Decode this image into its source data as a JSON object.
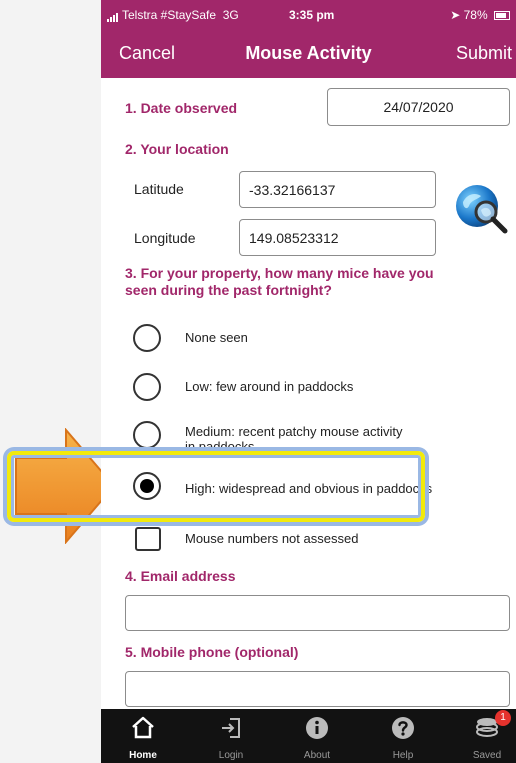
{
  "status": {
    "carrier": "Telstra #StaySafe",
    "network": "3G",
    "time": "3:35 pm",
    "battery": "78%"
  },
  "nav": {
    "cancel": "Cancel",
    "title": "Mouse Activity",
    "submit": "Submit"
  },
  "form": {
    "q1": {
      "label": "1. Date observed",
      "value": "24/07/2020"
    },
    "q2": {
      "label": "2. Your location",
      "latitude_label": "Latitude",
      "latitude": "-33.32166137",
      "longitude_label": "Longitude",
      "longitude": "149.08523312"
    },
    "q3": {
      "line1": "3. For your property, how many mice have you",
      "line2": "seen during the past fortnight?",
      "options": [
        {
          "line1": "None seen",
          "line2": ""
        },
        {
          "line1": "Low: few around in paddocks",
          "line2": ""
        },
        {
          "line1": "Medium: recent patchy mouse activity",
          "line2": "in paddocks"
        },
        {
          "line1": "High: widespread and obvious in paddocks",
          "line2": ""
        },
        {
          "line1": "Mouse numbers not assessed",
          "line2": ""
        }
      ],
      "selected_index": 3
    },
    "q4": {
      "label": "4. Email address",
      "value": ""
    },
    "q5": {
      "label": "5. Mobile phone (optional)",
      "value": ""
    }
  },
  "tabs": [
    {
      "label": "Home",
      "icon": "home-icon"
    },
    {
      "label": "Login",
      "icon": "login-icon"
    },
    {
      "label": "About",
      "icon": "info-icon"
    },
    {
      "label": "Help",
      "icon": "help-icon"
    },
    {
      "label": "Saved",
      "icon": "saved-icon",
      "badge": "1"
    }
  ],
  "colors": {
    "brand": "#a1276a",
    "highlight": "#f2ea0c",
    "arrow": "#f39a2c",
    "tabbar": "#121212"
  }
}
